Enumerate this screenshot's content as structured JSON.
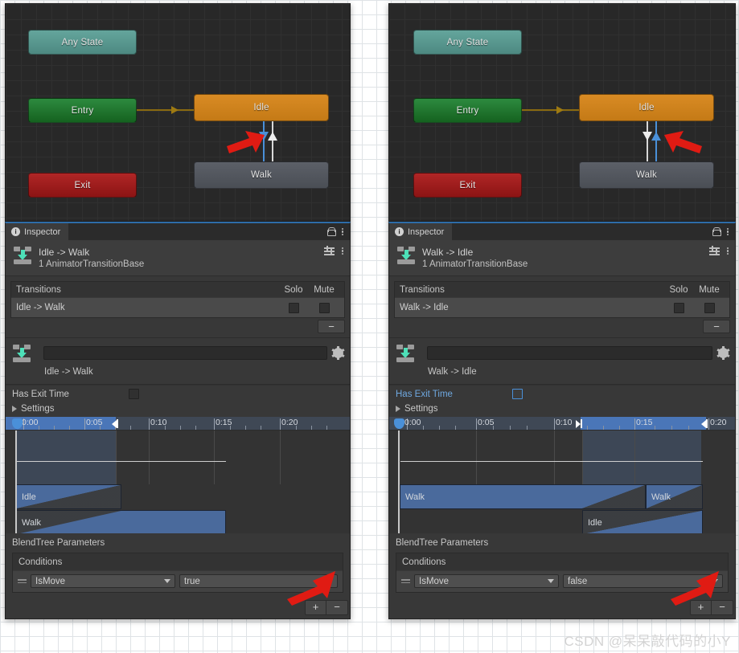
{
  "watermark": "CSDN @呆呆敲代码的小Y",
  "colors": {
    "accent_blue": "#4a90d9",
    "idle_node": "#d98b24",
    "walk_node": "#5c6068",
    "entry_node": "#2d8a3f",
    "exit_node": "#b02626",
    "anystate_node": "#64a59c",
    "clip_blue": "#4a6a9c",
    "red_arrow": "#e01b13"
  },
  "panels": [
    {
      "id": "left",
      "graph": {
        "nodes": [
          {
            "label": "Any State",
            "type": "anystate"
          },
          {
            "label": "Entry",
            "type": "entry"
          },
          {
            "label": "Exit",
            "type": "exit"
          },
          {
            "label": "Idle",
            "type": "idle"
          },
          {
            "label": "Walk",
            "type": "walk"
          }
        ],
        "selected_transition_direction": "down",
        "annotation_arrow": "red-arrow-pointing-right-at-transition"
      },
      "inspector": {
        "tab_label": "Inspector",
        "tab_icon": "info-icon",
        "lock_icon": "lock-icon",
        "menu_icon": "kebab-menu-icon",
        "object_title": "Idle -> Walk",
        "object_subtitle": "1 AnimatorTransitionBase",
        "object_icon": "transition-icon",
        "preset_icon": "preset-icon",
        "transitions": {
          "header": "Transitions",
          "col_solo": "Solo",
          "col_mute": "Mute",
          "rows": [
            {
              "name": "Idle -> Walk",
              "solo": false,
              "mute": false
            }
          ],
          "remove_button": "−"
        },
        "name_field_value": "",
        "gear_icon": "gear-icon",
        "transition_subname": "Idle -> Walk",
        "has_exit_time_label": "Has Exit Time",
        "has_exit_time_checked": false,
        "has_exit_time_highlighted": false,
        "settings_label": "Settings",
        "blendtree_params_label": "BlendTree Parameters",
        "conditions": {
          "header": "Conditions",
          "rows": [
            {
              "parameter": "IsMove",
              "value": "true"
            }
          ],
          "add_button": "+",
          "remove_button": "−"
        }
      },
      "timeline": {
        "ruler_labels": [
          "0:00",
          "0:05",
          "0:10",
          "0:15",
          "0:20"
        ],
        "selection_start": "0:00",
        "selection_end": "0:06",
        "clips": [
          {
            "label": "Idle",
            "row": 0
          },
          {
            "label": "Walk",
            "row": 1
          }
        ]
      }
    },
    {
      "id": "right",
      "graph": {
        "nodes": [
          {
            "label": "Any State",
            "type": "anystate"
          },
          {
            "label": "Entry",
            "type": "entry"
          },
          {
            "label": "Exit",
            "type": "exit"
          },
          {
            "label": "Idle",
            "type": "idle"
          },
          {
            "label": "Walk",
            "type": "walk"
          }
        ],
        "selected_transition_direction": "up",
        "annotation_arrow": "red-arrow-pointing-left-at-transition"
      },
      "inspector": {
        "tab_label": "Inspector",
        "tab_icon": "info-icon",
        "lock_icon": "lock-icon",
        "menu_icon": "kebab-menu-icon",
        "object_title": "Walk -> Idle",
        "object_subtitle": "1 AnimatorTransitionBase",
        "object_icon": "transition-icon",
        "preset_icon": "preset-icon",
        "transitions": {
          "header": "Transitions",
          "col_solo": "Solo",
          "col_mute": "Mute",
          "rows": [
            {
              "name": "Walk -> Idle",
              "solo": false,
              "mute": false
            }
          ],
          "remove_button": "−"
        },
        "name_field_value": "",
        "gear_icon": "gear-icon",
        "transition_subname": "Walk -> Idle",
        "has_exit_time_label": "Has Exit Time",
        "has_exit_time_checked": false,
        "has_exit_time_highlighted": true,
        "settings_label": "Settings",
        "blendtree_params_label": "BlendTree Parameters",
        "conditions": {
          "header": "Conditions",
          "rows": [
            {
              "parameter": "IsMove",
              "value": "false"
            }
          ],
          "add_button": "+",
          "remove_button": "−"
        }
      },
      "timeline": {
        "ruler_labels": [
          "0:00",
          "0:05",
          "0:10",
          "0:15",
          "0:20"
        ],
        "selection_start": "0:11",
        "selection_end": "0:17",
        "clips": [
          {
            "label": "Walk",
            "row": 0
          },
          {
            "label": "Walk",
            "row": 0
          },
          {
            "label": "Idle",
            "row": 1
          }
        ]
      }
    }
  ]
}
